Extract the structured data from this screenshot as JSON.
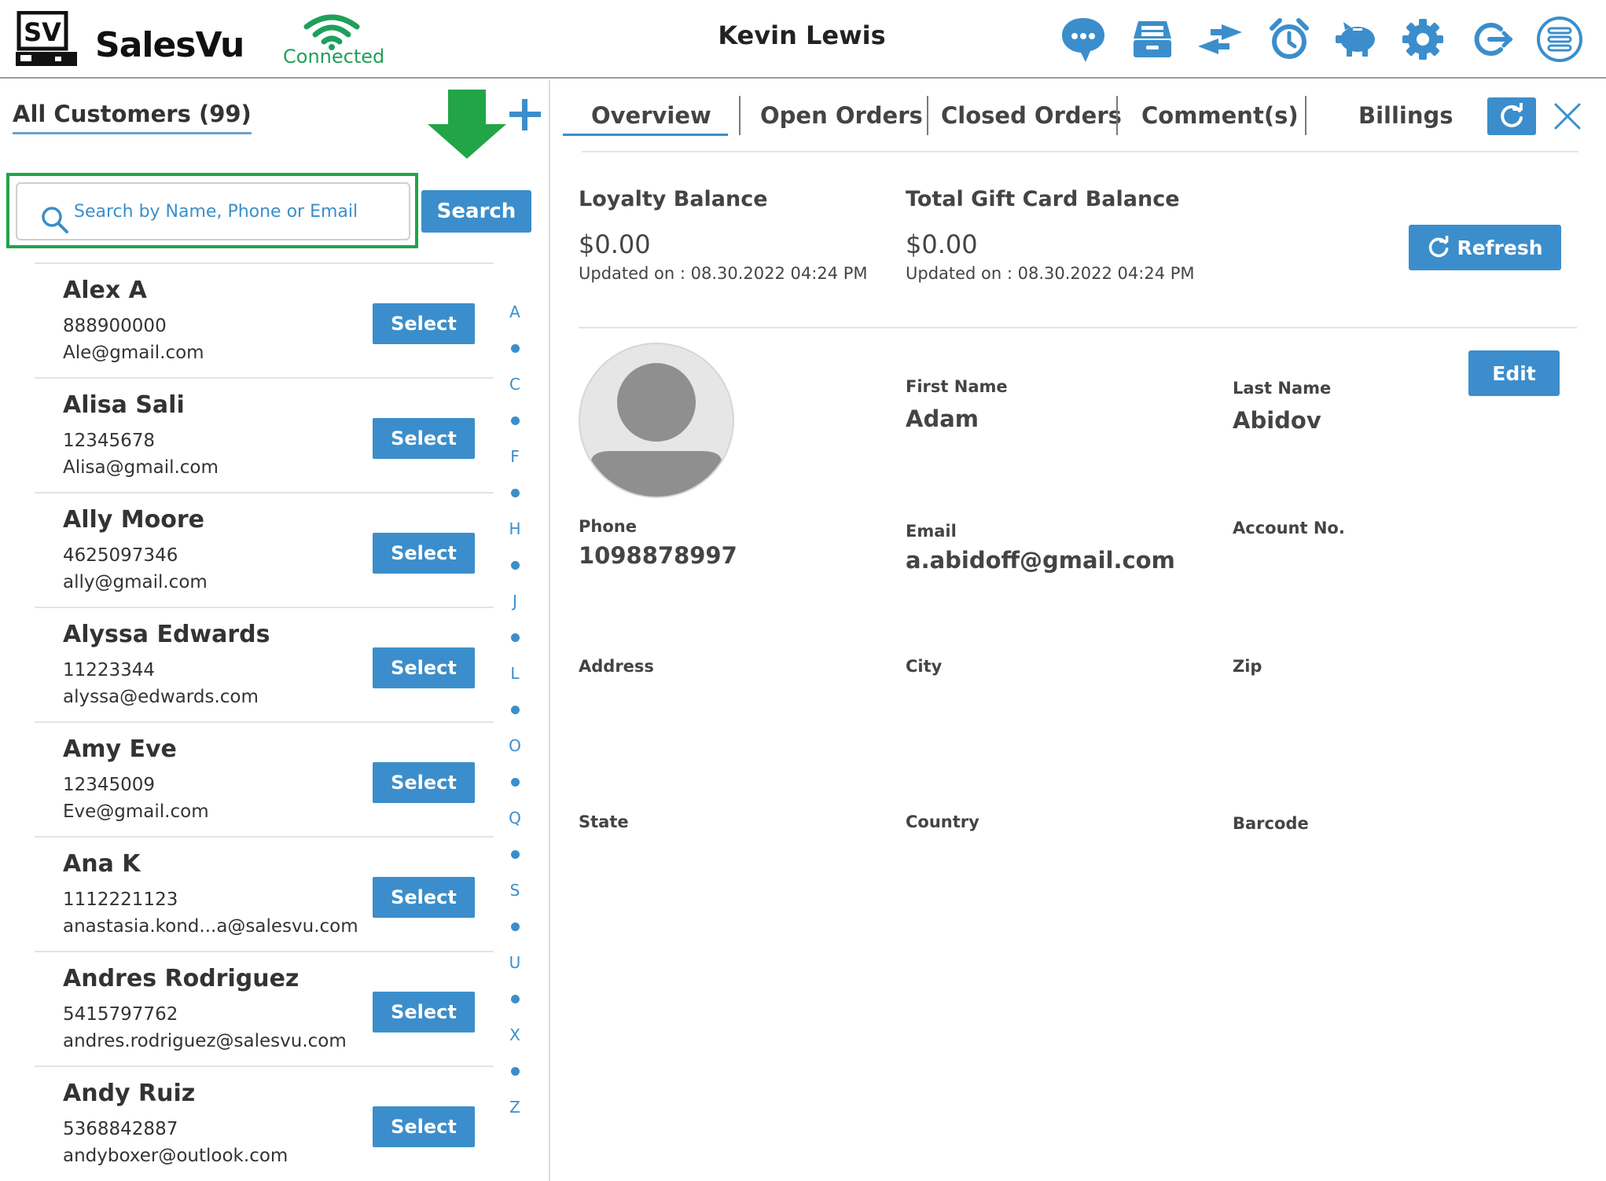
{
  "header": {
    "logo_mark": "SV",
    "brand": "SalesVu",
    "connection_status": "Connected",
    "user_name": "Kevin Lewis",
    "accent_color": "#3b8ecb",
    "connected_color": "#1fa05a",
    "icons": [
      "chat-icon",
      "cash-drawer-icon",
      "transfer-icon",
      "alarm-clock-icon",
      "piggy-bank-icon",
      "gear-icon",
      "logout-icon",
      "menu-list-icon"
    ]
  },
  "customers": {
    "title": "All Customers (99)",
    "search_placeholder": "Search by Name, Phone or Email",
    "search_button": "Search",
    "select_label": "Select",
    "list": [
      {
        "name": "Alex A",
        "phone": "888900000",
        "email": "Ale@gmail.com"
      },
      {
        "name": "Alisa Sali",
        "phone": "12345678",
        "email": "Alisa@gmail.com"
      },
      {
        "name": "Ally Moore",
        "phone": "4625097346",
        "email": "ally@gmail.com"
      },
      {
        "name": "Alyssa Edwards",
        "phone": "11223344",
        "email": "alyssa@edwards.com"
      },
      {
        "name": "Amy Eve",
        "phone": "12345009",
        "email": "Eve@gmail.com"
      },
      {
        "name": "Ana K",
        "phone": "1112221123",
        "email": "anastasia.kond...a@salesvu.com"
      },
      {
        "name": "Andres Rodriguez",
        "phone": "5415797762",
        "email": "andres.rodriguez@salesvu.com"
      },
      {
        "name": "Andy Ruiz",
        "phone": "5368842887",
        "email": "andyboxer@outlook.com"
      }
    ],
    "alpha_index": [
      "A",
      "C",
      "F",
      "H",
      "J",
      "L",
      "O",
      "Q",
      "S",
      "U",
      "X",
      "Z"
    ]
  },
  "tabs": {
    "overview": "Overview",
    "open_orders": "Open Orders",
    "closed_orders": "Closed Orders",
    "comments": "Comment(s)",
    "billings": "Billings",
    "active": "Overview"
  },
  "balances": {
    "loyalty_label": "Loyalty Balance",
    "loyalty_value": "$0.00",
    "loyalty_updated": "Updated on :  08.30.2022 04:24 PM",
    "gift_label": "Total Gift Card Balance",
    "gift_value": "$0.00",
    "gift_updated": "Updated on :  08.30.2022 04:24 PM",
    "refresh_label": "Refresh"
  },
  "profile": {
    "edit_label": "Edit",
    "first_name_label": "First Name",
    "first_name": "Adam",
    "last_name_label": "Last Name",
    "last_name": "Abidov",
    "phone_label": "Phone",
    "phone": "1098878997",
    "email_label": "Email",
    "email": "a.abidoff@gmail.com",
    "account_label": "Account No.",
    "address_label": "Address",
    "city_label": "City",
    "zip_label": "Zip",
    "state_label": "State",
    "country_label": "Country",
    "barcode_label": "Barcode"
  }
}
